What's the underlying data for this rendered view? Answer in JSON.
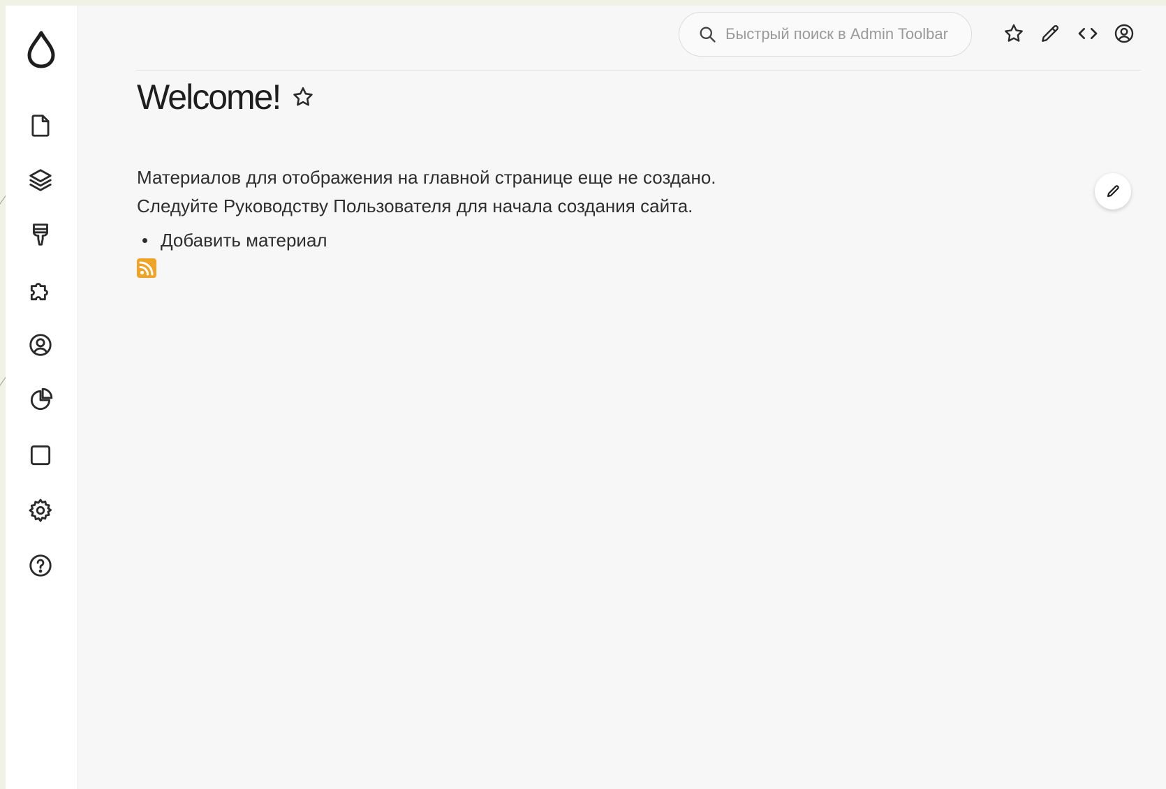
{
  "sidebar": {
    "logo_icon": "drop-icon",
    "items": [
      {
        "name": "content",
        "icon": "file-icon"
      },
      {
        "name": "structure",
        "icon": "layers-icon"
      },
      {
        "name": "appearance",
        "icon": "brush-icon"
      },
      {
        "name": "extend",
        "icon": "puzzle-icon"
      },
      {
        "name": "people",
        "icon": "user-circle-icon"
      },
      {
        "name": "reports",
        "icon": "pie-chart-icon"
      },
      {
        "name": "blocks",
        "icon": "square-icon"
      },
      {
        "name": "configuration",
        "icon": "gear-icon"
      },
      {
        "name": "help",
        "icon": "help-circle-icon"
      }
    ]
  },
  "toolbar": {
    "search": {
      "placeholder": "Быстрый поиск в Admin Toolbar",
      "value": ""
    },
    "buttons": [
      {
        "name": "shortcuts",
        "icon": "star-icon"
      },
      {
        "name": "edit",
        "icon": "pencil-icon"
      },
      {
        "name": "devel",
        "icon": "code-icon"
      },
      {
        "name": "user",
        "icon": "user-circle-icon"
      }
    ]
  },
  "main": {
    "title": "Welcome!",
    "title_icon": "star-outline-icon",
    "lines": [
      "Материалов для отображения на главной странице еще не создано.",
      "Следуйте Руководству Пользователя для начала создания сайта."
    ],
    "links": [
      "Добавить материал"
    ],
    "feed_icon": "rss-icon",
    "edit_icon": "pencil-icon"
  },
  "colors": {
    "accent_rss": "#f0a427",
    "text": "#2e2e2e",
    "background": "#f7f7f7",
    "sidebar": "#ffffff"
  }
}
